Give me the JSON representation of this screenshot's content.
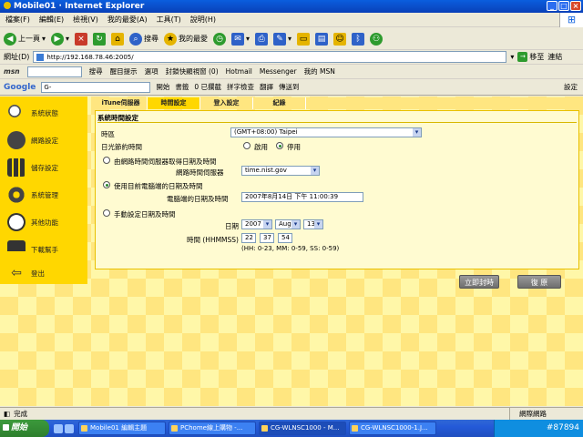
{
  "window": {
    "title": "Mobile01 · Internet Explorer"
  },
  "menu": [
    "檔案(F)",
    "編輯(E)",
    "檢視(V)",
    "我的最愛(A)",
    "工具(T)",
    "說明(H)"
  ],
  "toolbar": {
    "back": "上一頁",
    "search": "搜尋",
    "favorites": "我的最愛"
  },
  "address": {
    "label": "網址(D)",
    "url": "http://192.168.78.46:2005/",
    "go": "移至",
    "links": "連結"
  },
  "msn": {
    "logo": "msn",
    "search": "搜尋",
    "highlight": "醒目提示",
    "options": "選項",
    "popup": "封鎖快顯視窗 (0)",
    "hotmail": "Hotmail",
    "messenger": "Messenger",
    "mymsn": "我的 MSN"
  },
  "google": {
    "logo": "Google",
    "input": "G-",
    "go": "開始",
    "bookmarks": "書籤",
    "blocked": "0 已攔截",
    "spell": "拼字檢查",
    "translate": "翻譯",
    "send": "傳送到",
    "settings": "設定"
  },
  "sidebar": {
    "items": [
      {
        "label": "系統狀態",
        "icon": "magnifier-icon"
      },
      {
        "label": "網路設定",
        "icon": "network-icon"
      },
      {
        "label": "儲存設定",
        "icon": "storage-icon"
      },
      {
        "label": "系統管理",
        "icon": "gears-icon"
      },
      {
        "label": "其他功能",
        "icon": "clock-icon"
      },
      {
        "label": "下載幫手",
        "icon": "download-icon"
      },
      {
        "label": "登出",
        "icon": "logout-arrow-icon"
      }
    ]
  },
  "tabs": [
    "iTune伺服器",
    "時間設定",
    "登入設定",
    "紀錄"
  ],
  "panel": {
    "title": "系統時間設定",
    "timezone_label": "時區",
    "timezone_value": "(GMT+08:00) Taipei",
    "dst_label": "日光節約時間",
    "dst_enable": "啟用",
    "dst_disable": "停用",
    "opt_ntp": "由網路時間伺服器取得日期及時間",
    "ntp_server_label": "網路時間伺服器",
    "ntp_server_value": "time.nist.gov",
    "opt_pc": "使用目前電腦端的日期及時間",
    "pc_time_label": "電腦端的日期及時間",
    "pc_time_value": "2007年8月14日 下午 11:00:39",
    "opt_manual": "手動設定日期及時間",
    "date_label": "日期",
    "year": "2007",
    "month": "Aug",
    "day": "13",
    "time_label": "時間 (HHMMSS)",
    "hh": "22",
    "mm": "37",
    "ss": "54",
    "time_hint": "(HH: 0-23, MM: 0-59, SS: 0-59)"
  },
  "buttons": {
    "apply": "立即封時",
    "restore": "復 原"
  },
  "status": {
    "left": "完成",
    "zone": "網際網路"
  },
  "taskbar": {
    "start": "開始",
    "tasks": [
      "Mobile01 編輯主題",
      "PChome線上購物 -...",
      "CG-WLNSC1000 - M...",
      "CG-WLNSC1000-1.J..."
    ],
    "tray": "#87894"
  }
}
